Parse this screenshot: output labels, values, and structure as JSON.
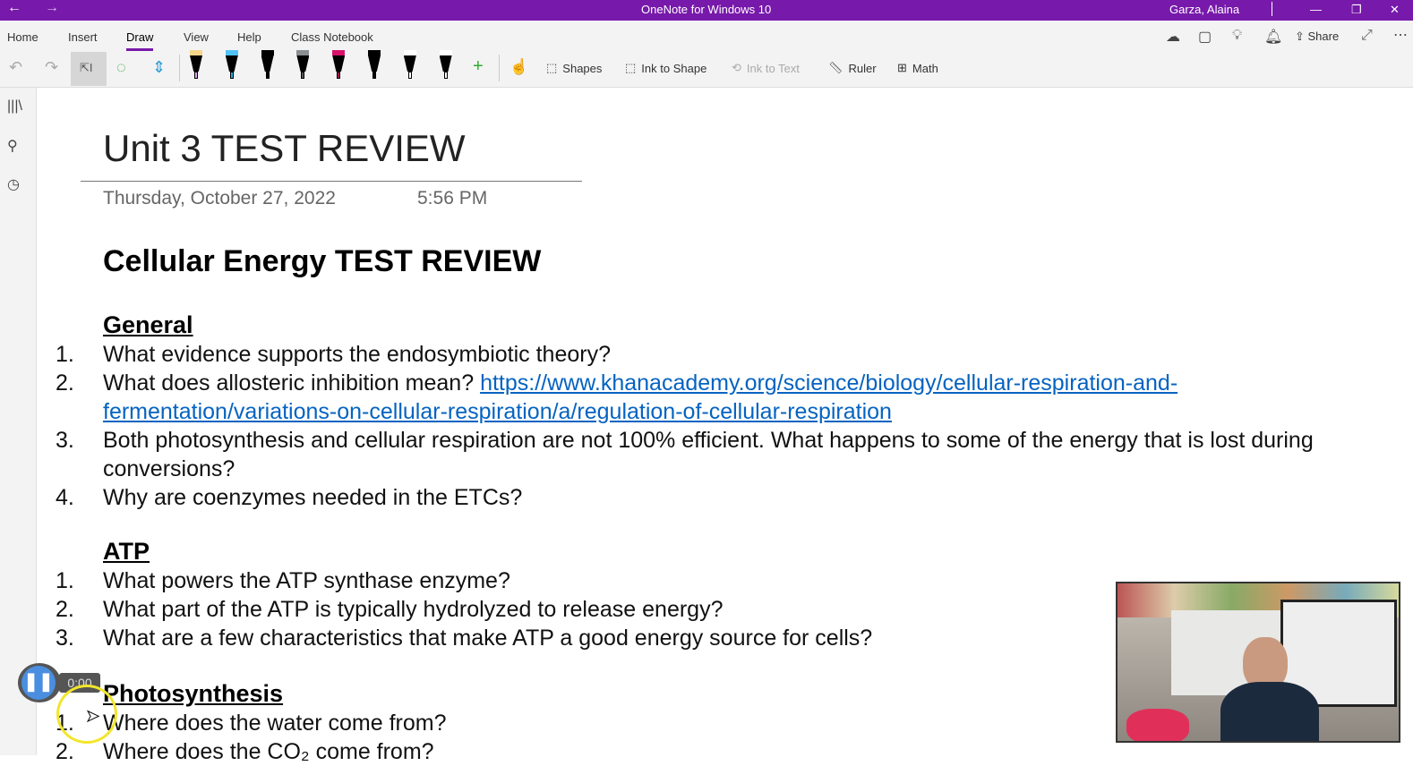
{
  "titlebar": {
    "title": "OneNote for Windows 10",
    "user": "Garza, Alaina"
  },
  "tabs": [
    "Home",
    "Insert",
    "Draw",
    "View",
    "Help",
    "Class Notebook"
  ],
  "toolbar": {
    "shapes": "Shapes",
    "ink_to_shape": "Ink to Shape",
    "ink_to_text": "Ink to Text",
    "ruler": "Ruler",
    "math": "Math",
    "share": "Share"
  },
  "pens": [
    {
      "cap": "#f5d58a",
      "tip": "#d9a6e6"
    },
    {
      "cap": "#4fc3f7",
      "tip": "#29a8e0"
    },
    {
      "cap": "#000000",
      "tip": "#000000"
    },
    {
      "cap": "#8a8f91",
      "tip": "#555555"
    },
    {
      "cap": "#d6136b",
      "tip": "#a0104f"
    },
    {
      "cap": "#000000",
      "tip": "#000000"
    },
    {
      "cap": "#ffffff",
      "tip": "#ffffff"
    },
    {
      "cap": "#ffffff",
      "tip": "#ffffff"
    }
  ],
  "page": {
    "title": "Unit 3 TEST REVIEW",
    "date": "Thursday, October 27, 2022",
    "time": "5:56 PM",
    "heading": "Cellular Energy TEST REVIEW",
    "general": {
      "title": "General",
      "items": [
        {
          "n": "1.",
          "text": "What evidence supports the endosymbiotic theory?"
        },
        {
          "n": "2.",
          "text": "What does allosteric inhibition mean? ",
          "link": "https://www.khanacademy.org/science/biology/cellular-respiration-and-fermentation/variations-on-cellular-respiration/a/regulation-of-cellular-respiration"
        },
        {
          "n": "3.",
          "text": "Both photosynthesis and cellular respiration are not 100% efficient. What happens to some of the energy that is lost during conversions?"
        },
        {
          "n": "4.",
          "text": "Why are coenzymes needed in the ETCs?"
        }
      ]
    },
    "atp": {
      "title": "ATP",
      "items": [
        {
          "n": "1.",
          "text": "What powers the ATP synthase enzyme?"
        },
        {
          "n": "2.",
          "text": "What part of the ATP is typically hydrolyzed to release energy?"
        },
        {
          "n": "3.",
          "text": "What are a few characteristics that make ATP a good energy source for cells?"
        }
      ]
    },
    "photo": {
      "title": "Photosynthesis",
      "items": [
        {
          "n": "1.",
          "text": "Where does the water come from?"
        },
        {
          "n": "2.",
          "text": "Where does the CO₂ come from?"
        }
      ]
    }
  },
  "recorder": {
    "time": "0:00"
  }
}
